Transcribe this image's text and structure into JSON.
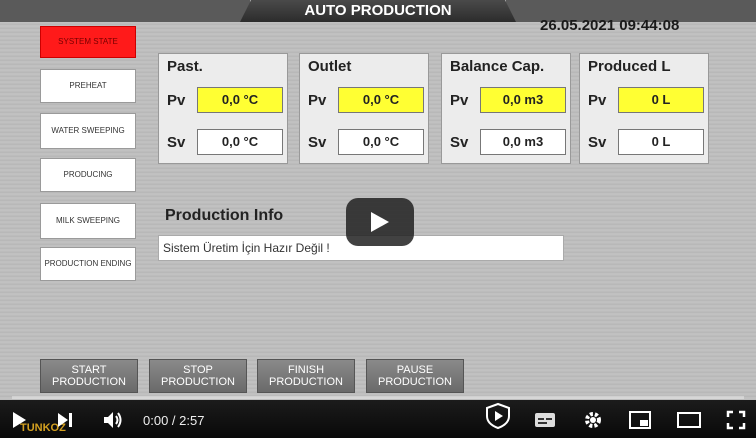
{
  "screen": {
    "title": "AUTO PRODUCTION",
    "datetime": "26.05.2021 09:44:08"
  },
  "sidebar": {
    "items": [
      {
        "label": "SYSTEM STATE",
        "state": "active"
      },
      {
        "label": "PREHEAT"
      },
      {
        "label": "WATER SWEEPING"
      },
      {
        "label": "PRODUCING"
      },
      {
        "label": "MILK SWEEPING"
      },
      {
        "label": "PRODUCTION ENDING"
      }
    ]
  },
  "panels": [
    {
      "title": "Past.",
      "pv_label": "Pv",
      "pv": "0,0 °C",
      "sv_label": "Sv",
      "sv": "0,0 °C"
    },
    {
      "title": "Outlet",
      "pv_label": "Pv",
      "pv": "0,0 °C",
      "sv_label": "Sv",
      "sv": "0,0 °C"
    },
    {
      "title": "Balance Cap.",
      "pv_label": "Pv",
      "pv": "0,0 m3",
      "sv_label": "Sv",
      "sv": "0,0 m3"
    },
    {
      "title": "Produced L",
      "pv_label": "Pv",
      "pv": "0 L",
      "sv_label": "Sv",
      "sv": "0 L"
    }
  ],
  "info": {
    "title": "Production Info",
    "message": "Sistem Üretim İçin Hazır Değil !"
  },
  "bottom_buttons": [
    {
      "label": "START PRODUCTION"
    },
    {
      "label": "STOP PRODUCTION"
    },
    {
      "label": "FINISH PRODUCTION"
    },
    {
      "label": "PAUSE PRODUCTION"
    }
  ],
  "player": {
    "time": "0:00 / 2:57",
    "logo": "TUNKOZ",
    "progress": 0,
    "icons": [
      "play-icon",
      "next-icon",
      "volume-icon",
      "shield-icon",
      "subtitles-icon",
      "settings-icon",
      "miniplayer-icon",
      "theater-icon",
      "fullscreen-icon"
    ]
  },
  "colors": {
    "pv_bg": "#ffff33",
    "active_red": "#ff1a1a"
  }
}
